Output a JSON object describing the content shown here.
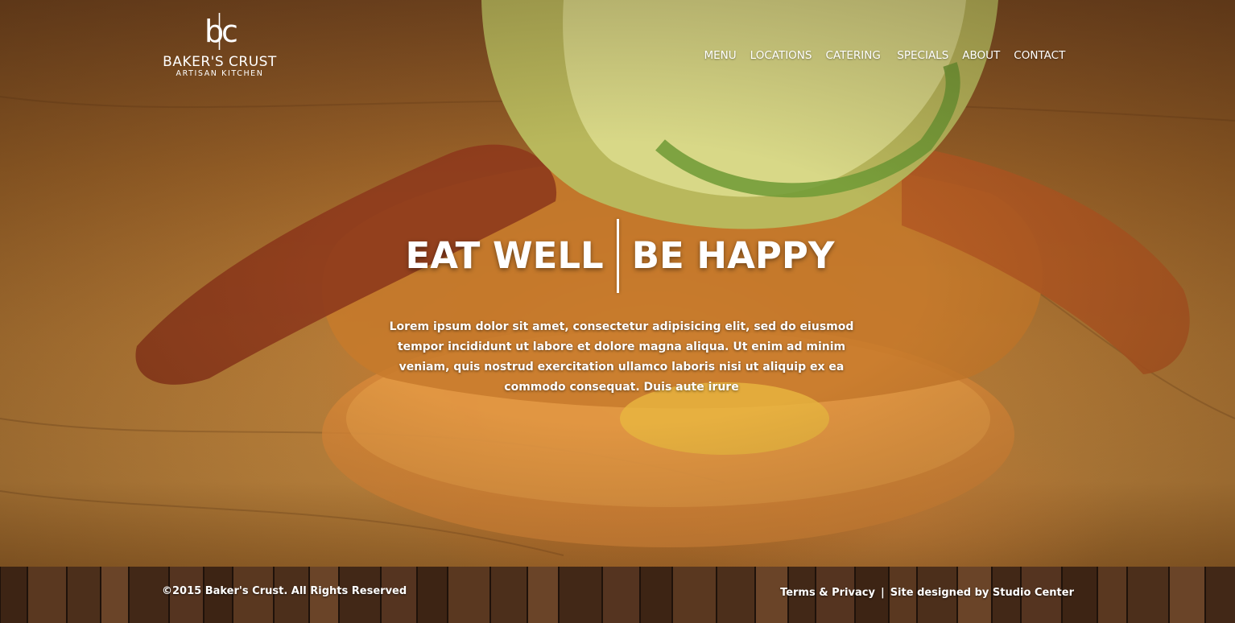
{
  "brand": {
    "logo_mark": "b|c",
    "name": "BAKER'S CRUST",
    "tagline": "ARTISAN KITCHEN"
  },
  "nav": {
    "items": [
      {
        "label": "MENU"
      },
      {
        "label": "LOCATIONS"
      },
      {
        "label": "CATERING"
      },
      {
        "label": "SPECIALS"
      },
      {
        "label": "ABOUT"
      },
      {
        "label": "CONTACT"
      }
    ]
  },
  "hero": {
    "headline_left": "EAT WELL",
    "headline_right": "BE HAPPY",
    "intro": "Lorem ipsum dolor sit amet, consectetur adipisicing elit, sed do eiusmod tempor incididunt ut labore et dolore magna aliqua. Ut enim ad minim veniam, quis nostrud exercitation ullamco laboris nisi ut aliquip ex ea commodo consequat. Duis aute irure"
  },
  "footer": {
    "copyright": "©2015 Baker's Crust. All Rights Reserved",
    "terms_label": "Terms & Privacy",
    "separator": "|",
    "credit_label": "Site designed by Studio Center"
  },
  "colors": {
    "text": "#ffffff",
    "footer_wood": "#4a2e1a",
    "hero_warm": "#b47a36"
  },
  "icons": {
    "logo": "bc-monogram-icon"
  }
}
